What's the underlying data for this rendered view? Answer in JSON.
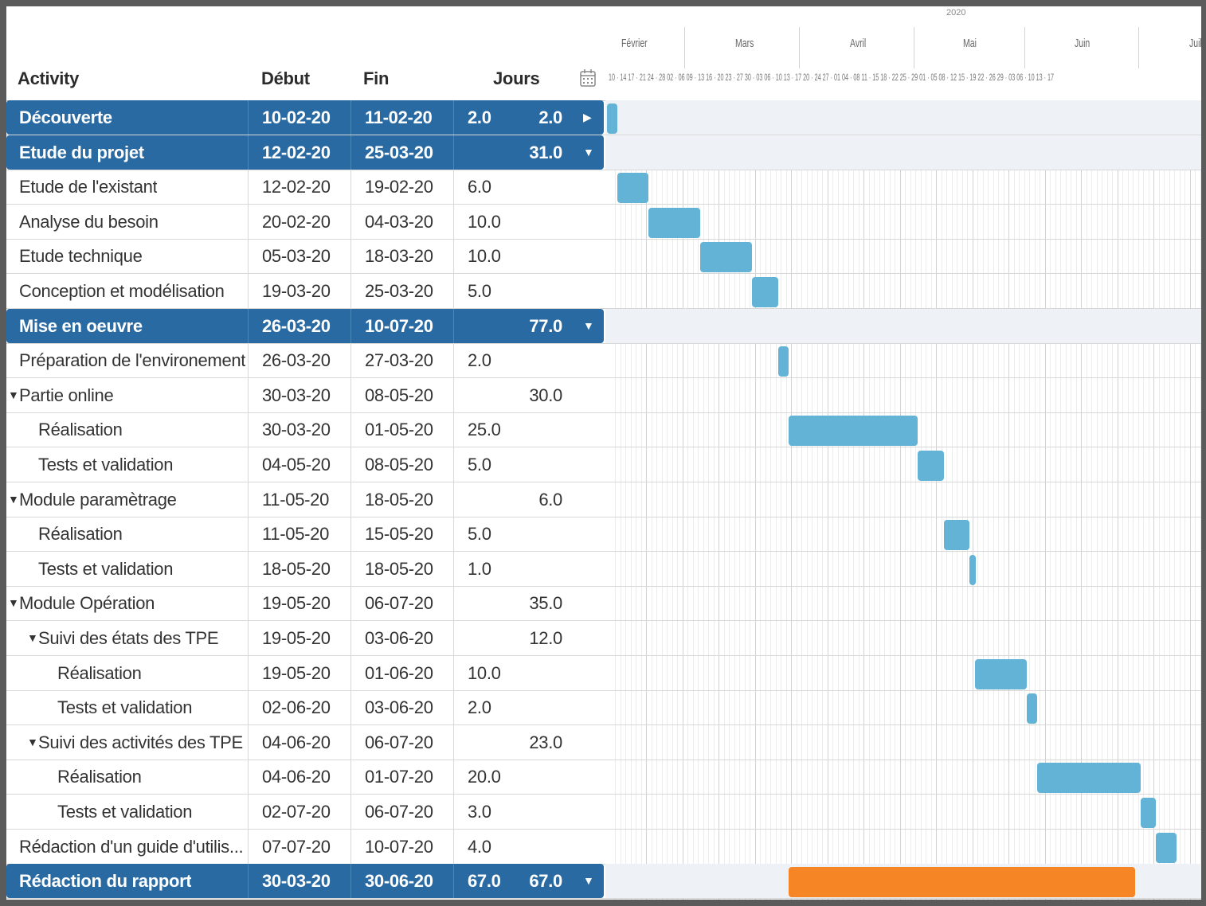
{
  "header": {
    "activity_label": "Activity",
    "start_label": "Début",
    "end_label": "Fin",
    "days_label": "Jours",
    "year": "2020",
    "months": [
      "Février",
      "Mars",
      "Avril",
      "Mai",
      "Juin",
      "Juil"
    ],
    "weeks": "10 · 14 17 · 21 24 · 28 02 · 06 09 · 13 16 · 20 23 · 27 30 · 03 06 · 10 13 · 17 20 · 24 27 · 01 04 · 08 11 · 15 18 · 22 25 · 29 01 · 05 08 · 12 15 · 19 22 · 26 29 · 03 06 · 10 13 · 17"
  },
  "colors": {
    "summary": "#2a6aa3",
    "bar": "#62b3d6",
    "bar_highlight": "#f58525"
  },
  "tasks": [
    {
      "name": "Découverte",
      "start": "10-02-20",
      "end": "11-02-20",
      "dur": "2.0",
      "total": "2.0",
      "summary": true,
      "toggle": "▶",
      "level": 0,
      "bar": [
        0,
        2
      ]
    },
    {
      "name": "Etude du projet",
      "start": "12-02-20",
      "end": "25-03-20",
      "dur": "",
      "total": "31.0",
      "summary": true,
      "toggle": "▼",
      "level": 0,
      "bar": null
    },
    {
      "name": "Etude de l'existant",
      "start": "12-02-20",
      "end": "19-02-20",
      "dur": "6.0",
      "total": "",
      "level": 0,
      "bar": [
        2,
        8
      ]
    },
    {
      "name": "Analyse du besoin",
      "start": "20-02-20",
      "end": "04-03-20",
      "dur": "10.0",
      "total": "",
      "level": 0,
      "bar": [
        8,
        18
      ]
    },
    {
      "name": "Etude technique",
      "start": "05-03-20",
      "end": "18-03-20",
      "dur": "10.0",
      "total": "",
      "level": 0,
      "bar": [
        18,
        28
      ]
    },
    {
      "name": "Conception et modélisation",
      "start": "19-03-20",
      "end": "25-03-20",
      "dur": "5.0",
      "total": "",
      "level": 0,
      "bar": [
        28,
        33
      ]
    },
    {
      "name": "Mise en oeuvre",
      "start": "26-03-20",
      "end": "10-07-20",
      "dur": "",
      "total": "77.0",
      "summary": true,
      "toggle": "▼",
      "level": 0,
      "bar": null
    },
    {
      "name": "Préparation de l'environement",
      "start": "26-03-20",
      "end": "27-03-20",
      "dur": "2.0",
      "total": "",
      "level": 0,
      "bar": [
        33,
        35
      ]
    },
    {
      "name": "Partie online",
      "start": "30-03-20",
      "end": "08-05-20",
      "dur": "",
      "total": "30.0",
      "group": true,
      "level": 0,
      "bar": null
    },
    {
      "name": "Réalisation",
      "start": "30-03-20",
      "end": "01-05-20",
      "dur": "25.0",
      "total": "",
      "level": 1,
      "bar": [
        35,
        60
      ]
    },
    {
      "name": "Tests et validation",
      "start": "04-05-20",
      "end": "08-05-20",
      "dur": "5.0",
      "total": "",
      "level": 1,
      "bar": [
        60,
        65
      ]
    },
    {
      "name": "Module paramètrage",
      "start": "11-05-20",
      "end": "18-05-20",
      "dur": "",
      "total": "6.0",
      "group": true,
      "level": 0,
      "bar": null
    },
    {
      "name": "Réalisation",
      "start": "11-05-20",
      "end": "15-05-20",
      "dur": "5.0",
      "total": "",
      "level": 1,
      "bar": [
        65,
        70
      ]
    },
    {
      "name": "Tests et validation",
      "start": "18-05-20",
      "end": "18-05-20",
      "dur": "1.0",
      "total": "",
      "level": 1,
      "bar": [
        70,
        71
      ]
    },
    {
      "name": "Module Opération",
      "start": "19-05-20",
      "end": "06-07-20",
      "dur": "",
      "total": "35.0",
      "group": true,
      "level": 0,
      "bar": null
    },
    {
      "name": "Suivi des états des TPE",
      "start": "19-05-20",
      "end": "03-06-20",
      "dur": "",
      "total": "12.0",
      "group": true,
      "level": 1,
      "bar": null
    },
    {
      "name": "Réalisation",
      "start": "19-05-20",
      "end": "01-06-20",
      "dur": "10.0",
      "total": "",
      "level": 2,
      "bar": [
        71,
        81
      ]
    },
    {
      "name": "Tests et validation",
      "start": "02-06-20",
      "end": "03-06-20",
      "dur": "2.0",
      "total": "",
      "level": 2,
      "bar": [
        81,
        83
      ]
    },
    {
      "name": "Suivi des activités des TPE",
      "start": "04-06-20",
      "end": "06-07-20",
      "dur": "",
      "total": "23.0",
      "group": true,
      "level": 1,
      "bar": null
    },
    {
      "name": "Réalisation",
      "start": "04-06-20",
      "end": "01-07-20",
      "dur": "20.0",
      "total": "",
      "level": 2,
      "bar": [
        83,
        103
      ]
    },
    {
      "name": "Tests et validation",
      "start": "02-07-20",
      "end": "06-07-20",
      "dur": "3.0",
      "total": "",
      "level": 2,
      "bar": [
        103,
        106
      ]
    },
    {
      "name": "Rédaction d'un guide d'utilis...",
      "start": "07-07-20",
      "end": "10-07-20",
      "dur": "4.0",
      "total": "",
      "level": 0,
      "bar": [
        106,
        110
      ]
    },
    {
      "name": "Rédaction du rapport",
      "start": "30-03-20",
      "end": "30-06-20",
      "dur": "67.0",
      "total": "67.0",
      "summary": true,
      "toggle": "▼",
      "level": 0,
      "bar": [
        35,
        102
      ],
      "highlight": true
    }
  ]
}
